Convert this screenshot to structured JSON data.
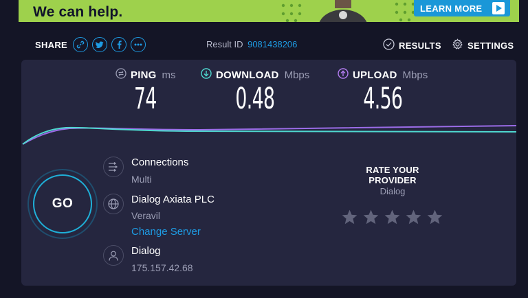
{
  "banner": {
    "headline_line2": "We can help.",
    "cta_label": "LEARN MORE",
    "colors": {
      "background": "#9ed14c",
      "cta": "#1a97d8"
    }
  },
  "header": {
    "share_label": "SHARE",
    "share_icons": [
      "link-icon",
      "twitter-icon",
      "facebook-icon",
      "more-icon"
    ],
    "result_id_label": "Result ID",
    "result_id": "9081438206",
    "results_label": "RESULTS",
    "settings_label": "SETTINGS"
  },
  "metrics": {
    "ping": {
      "label": "PING",
      "unit": "ms",
      "value": "74"
    },
    "download": {
      "label": "DOWNLOAD",
      "unit": "Mbps",
      "value": "0.48"
    },
    "upload": {
      "label": "UPLOAD",
      "unit": "Mbps",
      "value": "4.56"
    }
  },
  "go_label": "GO",
  "connection": {
    "connections_title": "Connections",
    "connections_value": "Multi",
    "server_title": "Dialog Axiata PLC",
    "server_location": "Veravil",
    "change_server": "Change Server",
    "isp_title": "Dialog",
    "ip": "175.157.42.68"
  },
  "rating": {
    "title": "RATE YOUR PROVIDER",
    "provider": "Dialog",
    "stars_total": 5,
    "stars_selected": 0
  },
  "colors": {
    "accent": "#1e9be3",
    "download_line": "#4fd8d0",
    "upload_line": "#9b6ce8",
    "panel": "#25263f",
    "background": "#141526"
  }
}
